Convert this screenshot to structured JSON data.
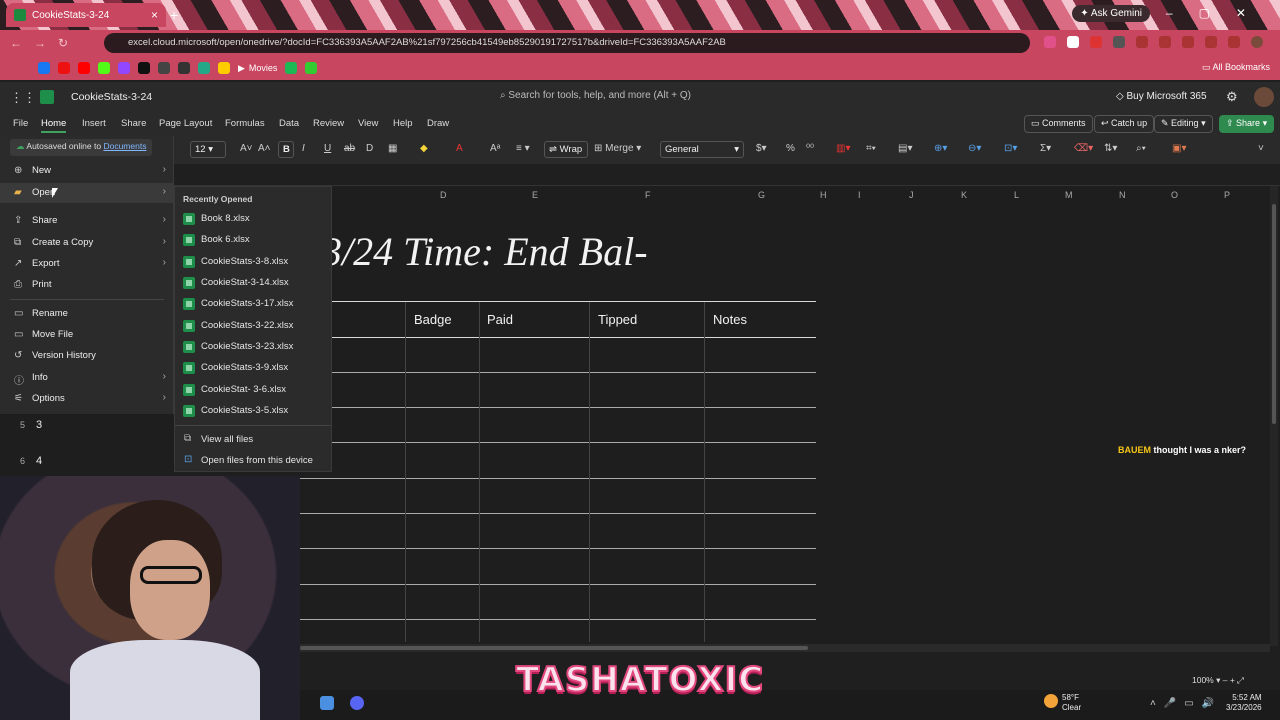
{
  "browser": {
    "tab_title": "CookieStats-3-24",
    "ask_gemini": "Ask Gemini",
    "url": "excel.cloud.microsoft/open/onedrive/?docId=FC336393A5AAF2AB%21sf797256cb41549eb85290191727517b&driveId=FC336393A5AAF2AB",
    "bookmark_movies": "Movies",
    "all_bookmarks": "All Bookmarks"
  },
  "excel": {
    "doc_title": "CookieStats-3-24",
    "search_placeholder": "Search for tools, help, and more (Alt + Q)",
    "buy": "Buy Microsoft 365",
    "tabs": [
      "File",
      "Home",
      "Insert",
      "Share",
      "Page Layout",
      "Formulas",
      "Data",
      "Review",
      "View",
      "Help",
      "Draw"
    ],
    "comments": "Comments",
    "catch_up": "Catch up",
    "editing": "Editing",
    "share": "Share"
  },
  "toolbar": {
    "font_size": "12",
    "bold": "B",
    "italic": "I",
    "wrap": "Wrap",
    "merge": "Merge",
    "number_format": "General"
  },
  "file_menu": {
    "autosave_prefix": "Autosaved online to",
    "autosave_link": "Documents",
    "items": [
      "New",
      "Open",
      "Share",
      "Create a Copy",
      "Export",
      "Print",
      "Rename",
      "Move File",
      "Version History",
      "Info",
      "Options"
    ]
  },
  "open_submenu": {
    "heading": "Recently Opened",
    "files": [
      "Book 8.xlsx",
      "Book 6.xlsx",
      "CookieStats-3-8.xlsx",
      "CookieStat-3-14.xlsx",
      "CookieStats-3-17.xlsx",
      "CookieStats-3-22.xlsx",
      "CookieStats-3-23.xlsx",
      "CookieStats-3-9.xlsx",
      "CookieStat- 3-6.xlsx",
      "CookieStats-3-5.xlsx"
    ],
    "view_all": "View all files",
    "open_device": "Open files from this device"
  },
  "sheet": {
    "columns": [
      "D",
      "E",
      "F",
      "G",
      "H",
      "I",
      "J",
      "K",
      "L",
      "M",
      "N",
      "O",
      "P"
    ],
    "title_text": "3/24 Time: End Bal-",
    "headers": [
      "Badge",
      "Paid",
      "Tipped",
      "Notes"
    ],
    "row_numbers": [
      "5",
      "6"
    ],
    "row_values": [
      "3",
      "4"
    ]
  },
  "chat": {
    "user": "BAUEM",
    "message": "thought I was a nker?"
  },
  "status": {
    "zoom": "100%"
  },
  "taskbar": {
    "temp": "58°F",
    "condition": "Clear",
    "time": "5:52 AM",
    "date": "3/23/2026"
  },
  "overlay": {
    "brand": "TASHATOXIC"
  }
}
